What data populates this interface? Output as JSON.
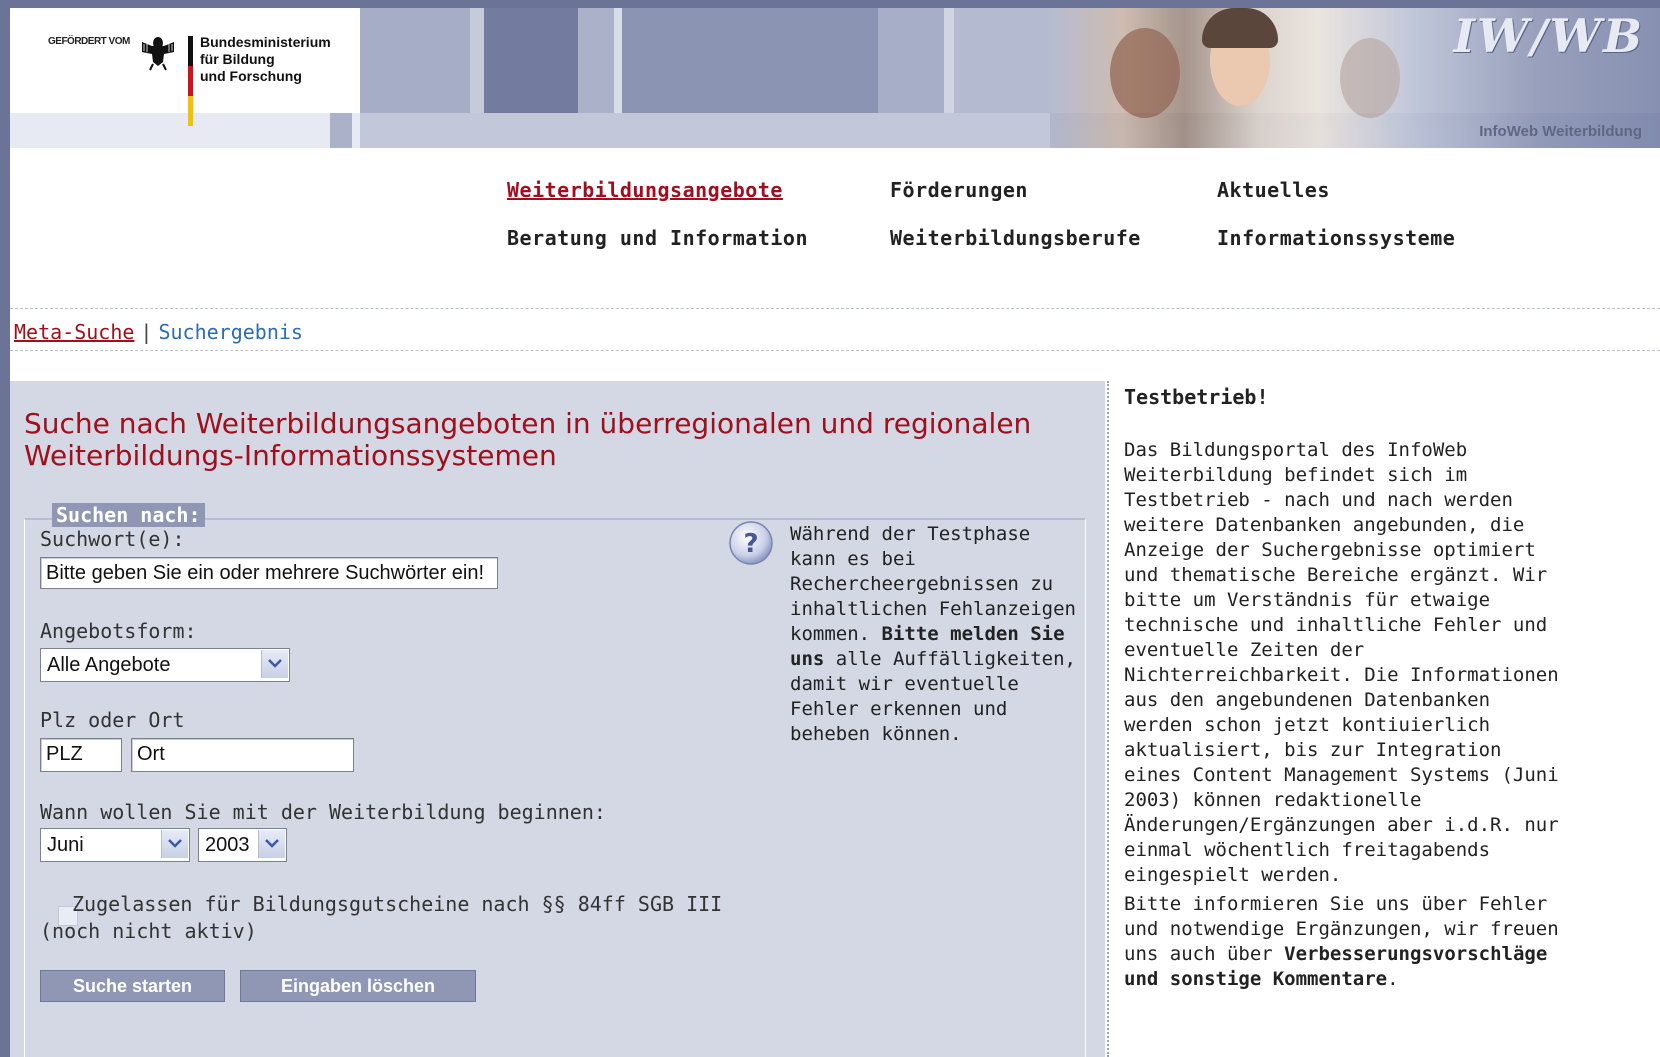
{
  "banner": {
    "sponsor_label": "GEFÖRDERT VOM",
    "ministry_line1": "Bundesministerium",
    "ministry_line2": "für Bildung",
    "ministry_line3": "und Forschung",
    "brand_logo": "IW/WB",
    "brand_subtitle": "InfoWeb Weiterbildung"
  },
  "nav": {
    "items": [
      {
        "label": "Weiterbildungsangebote",
        "active": true
      },
      {
        "label": "Förderungen",
        "active": false
      },
      {
        "label": "Aktuelles",
        "active": false
      },
      {
        "label": "Beratung und Information",
        "active": false
      },
      {
        "label": "Weiterbildungsberufe",
        "active": false
      },
      {
        "label": "Informationssysteme",
        "active": false
      }
    ]
  },
  "breadcrumb": {
    "link": "Meta-Suche",
    "separator": "|",
    "current": "Suchergebnis"
  },
  "main": {
    "headline_line1": "Suche nach Weiterbildungsangeboten in überregionalen und regionalen",
    "headline_line2": "Weiterbildungs-Informationssystemen"
  },
  "form": {
    "legend": "Suchen nach:",
    "keyword_label": "Suchwort(e):",
    "keyword_value": "Bitte geben Sie ein oder mehrere Suchwörter ein!",
    "offer_label": "Angebotsform:",
    "offer_selected": "Alle Angebote",
    "location_label": "Plz oder Ort",
    "plz_value": "PLZ",
    "ort_value": "Ort",
    "start_label": "Wann wollen Sie mit der Weiterbildung beginnen:",
    "month_selected": "Juni",
    "year_selected": "2003",
    "voucher_label_line1": "Zugelassen für Bildungsgutscheine nach §§ 84ff SGB III",
    "voucher_label_line2": "(noch nicht aktiv)",
    "submit_label": "Suche starten",
    "reset_label": "Eingaben löschen"
  },
  "help": {
    "text_before": "Während der Testphase kann es bei Rechercheergebnissen zu inhaltlichen Fehlanzeigen kommen.",
    "text_bold": "Bitte melden Sie uns",
    "text_after": "alle Auffälligkeiten, damit wir eventuelle Fehler erkennen und beheben können."
  },
  "sidebar": {
    "title": "Testbetrieb!",
    "paragraph1": "Das Bildungsportal des InfoWeb Weiterbildung befindet sich im Testbetrieb - nach und nach werden weitere Datenbanken angebunden, die Anzeige der Suchergebnisse optimiert und thematische Bereiche ergänzt. Wir bitte um Verständnis für etwaige technische und inhaltliche Fehler und eventuelle Zeiten der Nichterreichbarkeit. Die Informationen aus den angebundenen Datenbanken werden schon jetzt kontiuierlich aktualisiert, bis zur Integration eines Content Management Systems (Juni 2003) können redaktionelle Änderungen/Ergänzungen aber i.d.R. nur einmal wöchentlich freitagabends eingespielt werden.",
    "paragraph2_before": "Bitte informieren Sie uns über Fehler und notwendige Ergänzungen, wir freuen uns auch über",
    "paragraph2_bold": "Verbesserungsvorschläge und sonstige Kommentare",
    "paragraph2_after": "."
  },
  "colors": {
    "accent_red": "#a0101c",
    "link_blue": "#2a6cb6",
    "panel_grey": "#d4d8e5",
    "button_bg": "#8f97b5"
  }
}
